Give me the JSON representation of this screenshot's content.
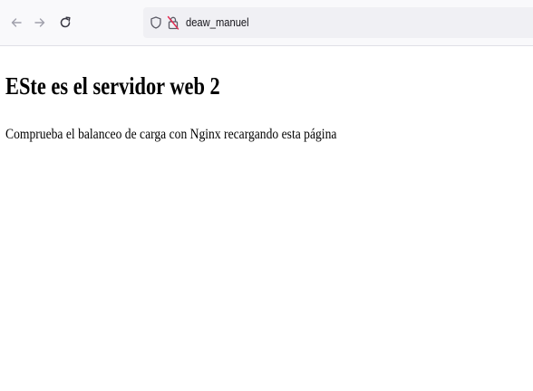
{
  "browser": {
    "toolbar": {
      "back_icon": "arrow-left-icon",
      "forward_icon": "arrow-right-icon",
      "reload_icon": "reload-icon"
    },
    "address_bar": {
      "shield_icon": "tracking-protection-shield-icon",
      "security_icon": "insecure-lock-icon",
      "url": "deaw_manuel"
    },
    "colors": {
      "toolbar_bg": "#f9f9fb",
      "urlbar_bg": "#f0f0f4",
      "insecure_lock": "#e22850",
      "nav_icon": "#8f8f9d"
    }
  },
  "page": {
    "heading": "ESte es el servidor web 2",
    "paragraph": "Comprueba el balanceo de carga con Nginx recargando esta página"
  }
}
